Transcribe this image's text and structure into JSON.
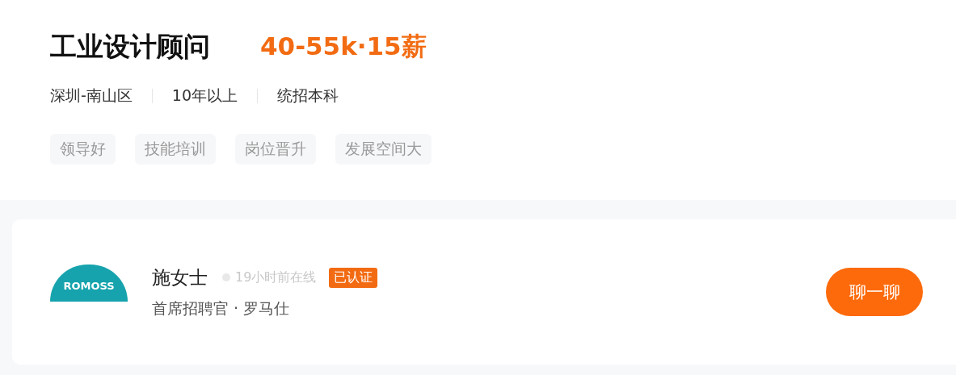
{
  "job": {
    "title": "工业设计顾问",
    "salary": "40-55k·15薪",
    "meta": [
      "深圳-南山区",
      "10年以上",
      "统招本科"
    ],
    "tags": [
      "领导好",
      "技能培训",
      "岗位晋升",
      "发展空间大"
    ]
  },
  "recruiter": {
    "logo_text": "ROMOSS",
    "name": "施女士",
    "last_online": "19小时前在线",
    "badge": "已认证",
    "role": "首席招聘官 · 罗马仕"
  },
  "chat_button": "聊一聊"
}
